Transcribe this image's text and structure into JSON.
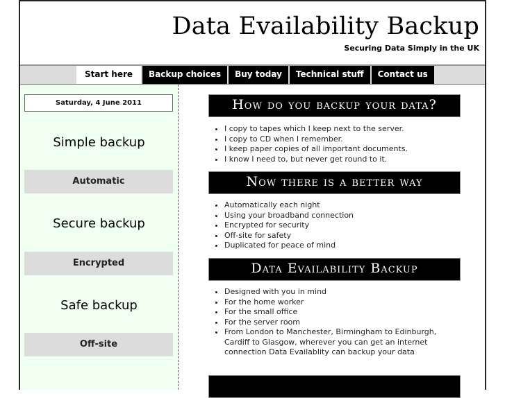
{
  "header": {
    "title": "Data Evailability Backup",
    "tagline": "Securing Data Simply in the UK"
  },
  "nav": {
    "items": [
      {
        "label": "Start here",
        "active": true
      },
      {
        "label": "Backup choices",
        "active": false
      },
      {
        "label": "Buy today",
        "active": false
      },
      {
        "label": "Technical stuff",
        "active": false
      },
      {
        "label": "Contact us",
        "active": false
      }
    ]
  },
  "sidebar": {
    "date": "Saturday, 4 June 2011",
    "features": [
      {
        "title": "Simple backup",
        "label": "Automatic"
      },
      {
        "title": "Secure backup",
        "label": "Encrypted"
      },
      {
        "title": "Safe backup",
        "label": "Off-site"
      }
    ]
  },
  "content": {
    "sections": [
      {
        "heading": "How do you backup your data?",
        "items": [
          "I copy to tapes which I keep next to the server.",
          "I copy to CD when I remember.",
          "I keep paper copies of all important documents.",
          "I know I need to, but never get round to it."
        ]
      },
      {
        "heading": "Now there is a better way",
        "items": [
          "Automatically each night",
          "Using your broadband connection",
          "Encrypted for security",
          "Off-site for safety",
          "Duplicated for peace of mind"
        ]
      },
      {
        "heading": "Data Evailability Backup",
        "items": [
          "Designed with you in mind",
          "For the home worker",
          "For the small office",
          "For the server room",
          "From London to Manchester, Birmingham to Edinburgh, Cardiff to Glasgow, wherever you can get an internet connection Data Evailablity can backup your data"
        ]
      },
      {
        "heading": "",
        "items": []
      }
    ]
  }
}
